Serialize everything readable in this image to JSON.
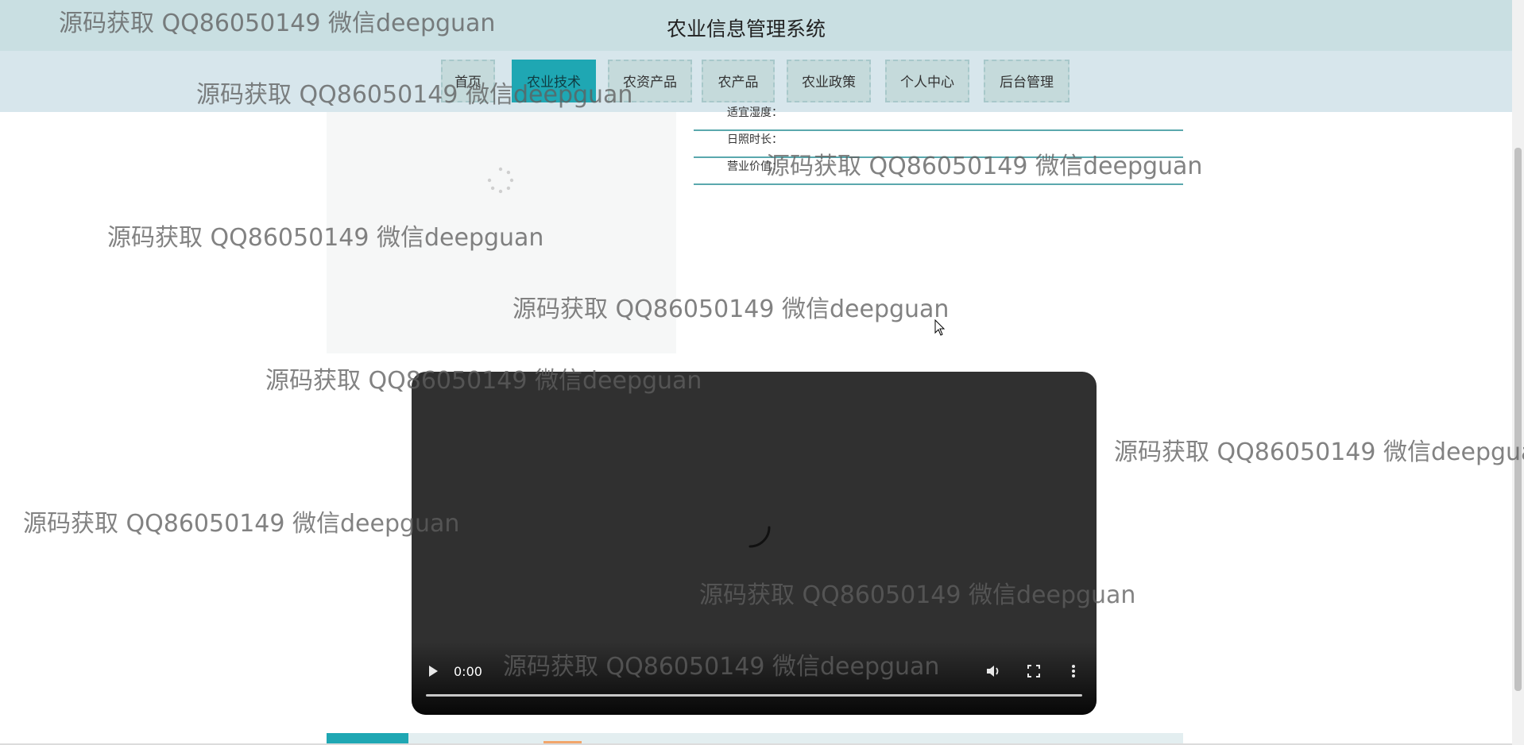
{
  "header": {
    "title": "农业信息管理系统"
  },
  "nav": {
    "items": [
      {
        "label": "首页"
      },
      {
        "label": "农业技术"
      },
      {
        "label": "农资产品"
      },
      {
        "label": "农产品"
      },
      {
        "label": "农业政策"
      },
      {
        "label": "个人中心"
      },
      {
        "label": "后台管理"
      }
    ],
    "active_index": 1
  },
  "details": {
    "rows": [
      {
        "label": "适宜湿度："
      },
      {
        "label": "日照时长："
      },
      {
        "label": "营业价值："
      }
    ]
  },
  "video": {
    "time": "0:00",
    "progress": 0,
    "icons": [
      "play-icon",
      "volume-icon",
      "fullscreen-icon",
      "more-options-icon"
    ]
  },
  "watermark": {
    "text": "源码获取 QQ86050149 微信deepguan"
  },
  "colors": {
    "header_bg": "#c9dfe2",
    "nav_bg": "#d7e6ec",
    "nav_item_bg": "#c5dadb",
    "active_nav_bg": "#1fa7b3",
    "divider": "#5aa8ad",
    "video_bg": "#303030"
  }
}
